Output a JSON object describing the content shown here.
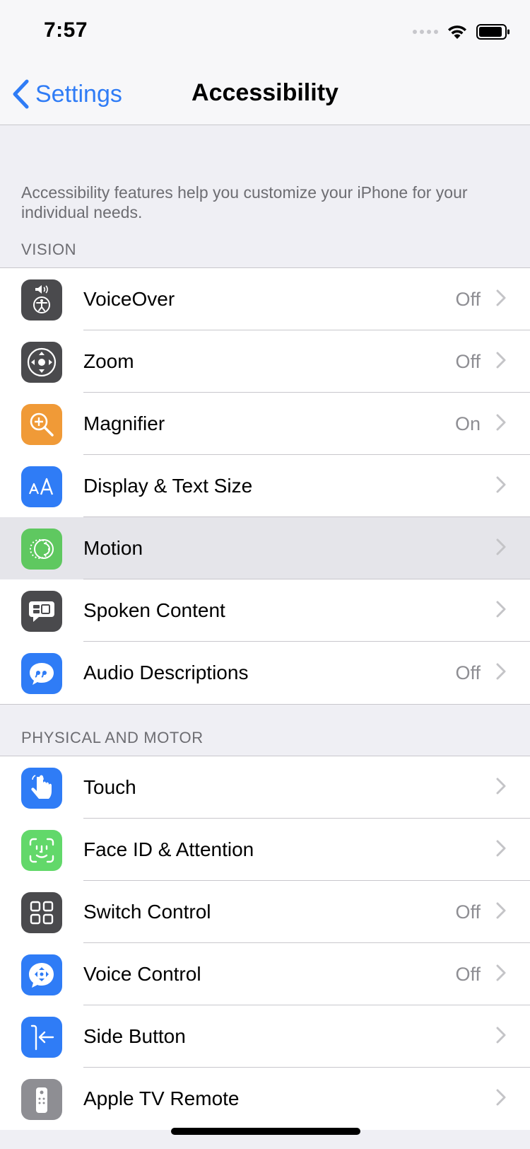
{
  "status": {
    "time": "7:57"
  },
  "nav": {
    "back_label": "Settings",
    "title": "Accessibility"
  },
  "intro": "Accessibility features help you customize your iPhone for your individual needs.",
  "sections": [
    {
      "header": "VISION",
      "rows": [
        {
          "label": "VoiceOver",
          "value": "Off",
          "icon": "voiceover-icon",
          "color": "#4a4a4d"
        },
        {
          "label": "Zoom",
          "value": "Off",
          "icon": "zoom-icon",
          "color": "#4a4a4d"
        },
        {
          "label": "Magnifier",
          "value": "On",
          "icon": "magnifier-icon",
          "color": "#f09a37"
        },
        {
          "label": "Display & Text Size",
          "value": "",
          "icon": "display-text-size-icon",
          "color": "#2f7cf6"
        },
        {
          "label": "Motion",
          "value": "",
          "icon": "motion-icon",
          "color": "#5fc860",
          "highlighted": true
        },
        {
          "label": "Spoken Content",
          "value": "",
          "icon": "spoken-content-icon",
          "color": "#4a4a4d"
        },
        {
          "label": "Audio Descriptions",
          "value": "Off",
          "icon": "audio-descriptions-icon",
          "color": "#2f7cf6"
        }
      ]
    },
    {
      "header": "PHYSICAL AND MOTOR",
      "rows": [
        {
          "label": "Touch",
          "value": "",
          "icon": "touch-icon",
          "color": "#2f7cf6"
        },
        {
          "label": "Face ID & Attention",
          "value": "",
          "icon": "face-id-icon",
          "color": "#62d86a"
        },
        {
          "label": "Switch Control",
          "value": "Off",
          "icon": "switch-control-icon",
          "color": "#4a4a4d"
        },
        {
          "label": "Voice Control",
          "value": "Off",
          "icon": "voice-control-icon",
          "color": "#2f7cf6"
        },
        {
          "label": "Side Button",
          "value": "",
          "icon": "side-button-icon",
          "color": "#2f7cf6"
        },
        {
          "label": "Apple TV Remote",
          "value": "",
          "icon": "apple-tv-remote-icon",
          "color": "#8e8e93"
        }
      ]
    }
  ]
}
